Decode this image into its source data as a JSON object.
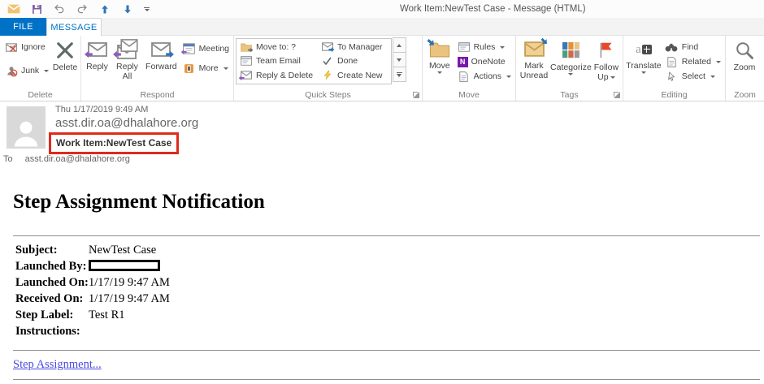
{
  "title_bar": {
    "title": "Work Item:NewTest Case - Message (HTML)"
  },
  "tabs": {
    "file": "FILE",
    "message": "MESSAGE"
  },
  "ribbon": {
    "delete_group": {
      "label": "Delete",
      "ignore": "Ignore",
      "junk": "Junk",
      "delete_button": "Delete"
    },
    "respond_group": {
      "label": "Respond",
      "reply": "Reply",
      "reply_all": "Reply All",
      "forward": "Forward",
      "meeting": "Meeting",
      "more": "More"
    },
    "quick_steps_group": {
      "label": "Quick Steps",
      "items": [
        {
          "label": "Move to: ?"
        },
        {
          "label": "Team Email"
        },
        {
          "label": "Reply & Delete"
        },
        {
          "label": "To Manager"
        },
        {
          "label": "Done"
        },
        {
          "label": "Create New"
        }
      ]
    },
    "move_group": {
      "label": "Move",
      "move_button": "Move",
      "rules": "Rules",
      "onenote": "OneNote",
      "actions": "Actions"
    },
    "tags_group": {
      "label": "Tags",
      "mark_unread": "Mark Unread",
      "categorize": "Categorize",
      "follow_up": "Follow Up"
    },
    "editing_group": {
      "label": "Editing",
      "translate": "Translate",
      "find": "Find",
      "related": "Related",
      "select": "Select"
    },
    "zoom_group": {
      "label": "Zoom",
      "zoom_button": "Zoom"
    }
  },
  "icons": {
    "onenote_letter": "N",
    "translate_letter": "a"
  },
  "header": {
    "date": "Thu 1/17/2019 9:49 AM",
    "sender": "asst.dir.oa@dhalahore.org",
    "subject": "Work Item:NewTest Case",
    "to_label": "To",
    "to_value": "asst.dir.oa@dhalahore.org"
  },
  "message": {
    "heading": "Step Assignment Notification",
    "fields": [
      {
        "label": "Subject:",
        "value": "NewTest Case"
      },
      {
        "label": "Launched By:",
        "value": "",
        "redacted": true
      },
      {
        "label": "Launched On:",
        "value": "1/17/19 9:47 AM"
      },
      {
        "label": "Received On:",
        "value": "1/17/19 9:47 AM"
      },
      {
        "label": "Step Label:",
        "value": "Test R1"
      },
      {
        "label": "Instructions:",
        "value": ""
      }
    ],
    "link": "Step Assignment..."
  },
  "colors": {
    "accent_blue": "#0072c6",
    "subject_highlight_border": "#e02a1a",
    "link": "#4a4ae0",
    "redaction_border": "#000000",
    "follow_up_flag": "#e8472b"
  }
}
